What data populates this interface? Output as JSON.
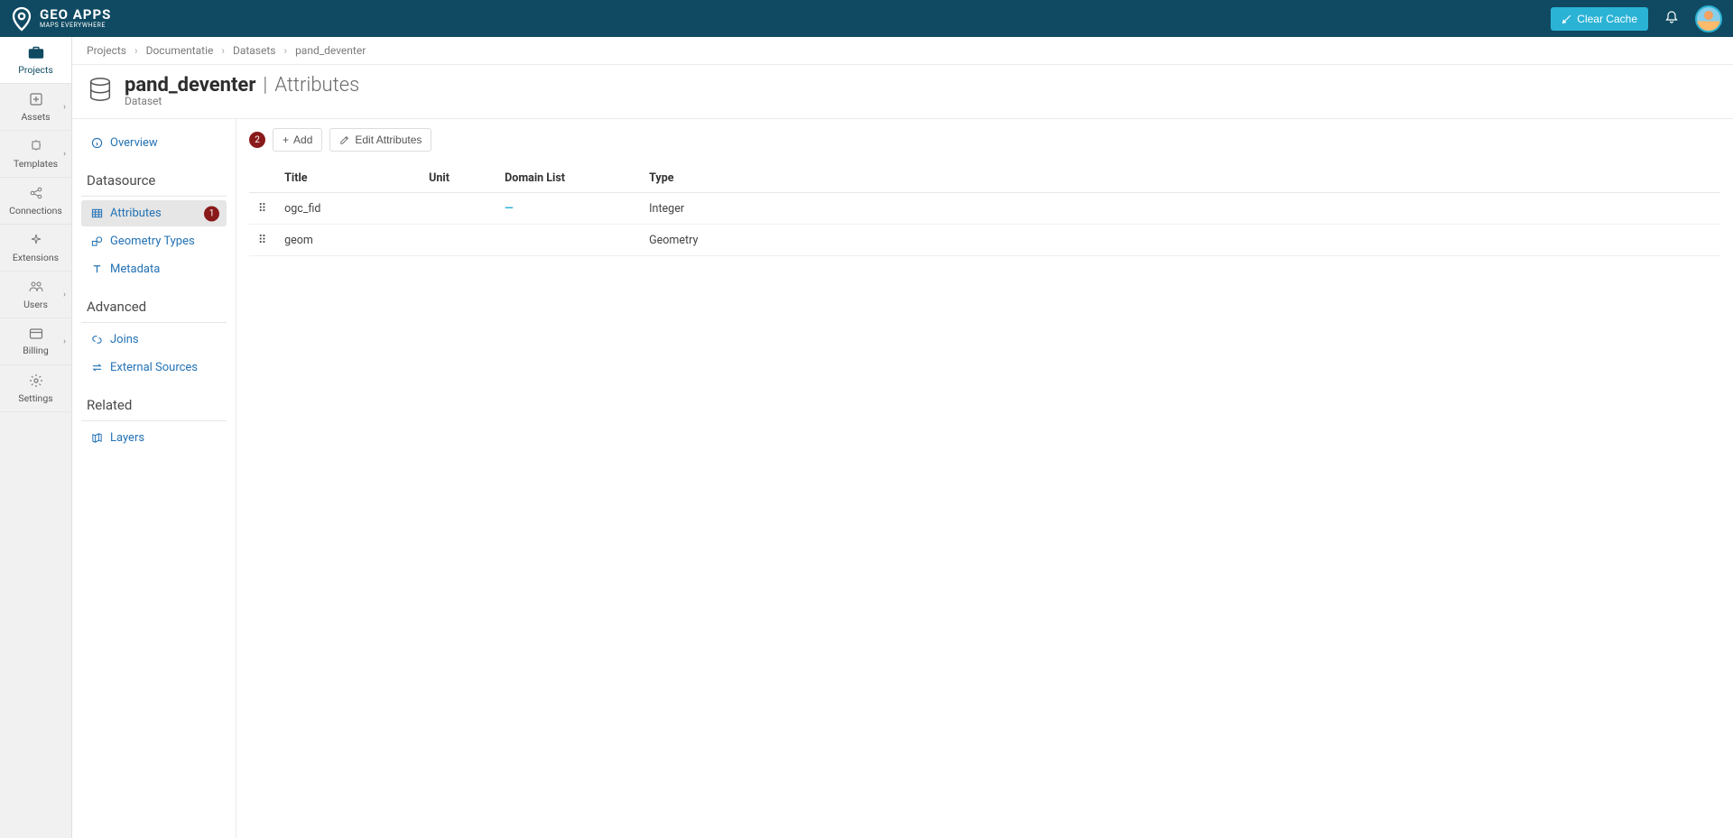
{
  "brand": {
    "title": "GEO APPS",
    "subtitle": "MAPS EVERYWHERE"
  },
  "header": {
    "clear_cache": "Clear Cache"
  },
  "vnav": {
    "projects": "Projects",
    "assets": "Assets",
    "templates": "Templates",
    "connections": "Connections",
    "extensions": "Extensions",
    "users": "Users",
    "billing": "Billing",
    "settings": "Settings"
  },
  "breadcrumb": {
    "projects": "Projects",
    "documentatie": "Documentatie",
    "datasets": "Datasets",
    "current": "pand_deventer"
  },
  "page": {
    "title": "pand_deventer",
    "section": "Attributes",
    "subtype": "Dataset"
  },
  "snav": {
    "overview": "Overview",
    "group_datasource": "Datasource",
    "attributes": "Attributes",
    "attributes_badge": "1",
    "geometry_types": "Geometry Types",
    "metadata": "Metadata",
    "group_advanced": "Advanced",
    "joins": "Joins",
    "external_sources": "External Sources",
    "group_related": "Related",
    "layers": "Layers"
  },
  "toolbar": {
    "badge": "2",
    "add": "Add",
    "edit": "Edit Attributes"
  },
  "table": {
    "headers": {
      "title": "Title",
      "unit": "Unit",
      "domain": "Domain List",
      "type": "Type"
    },
    "rows": [
      {
        "title": "ogc_fid",
        "unit": "",
        "domain": "—",
        "type": "Integer"
      },
      {
        "title": "geom",
        "unit": "",
        "domain": "",
        "type": "Geometry"
      }
    ]
  }
}
